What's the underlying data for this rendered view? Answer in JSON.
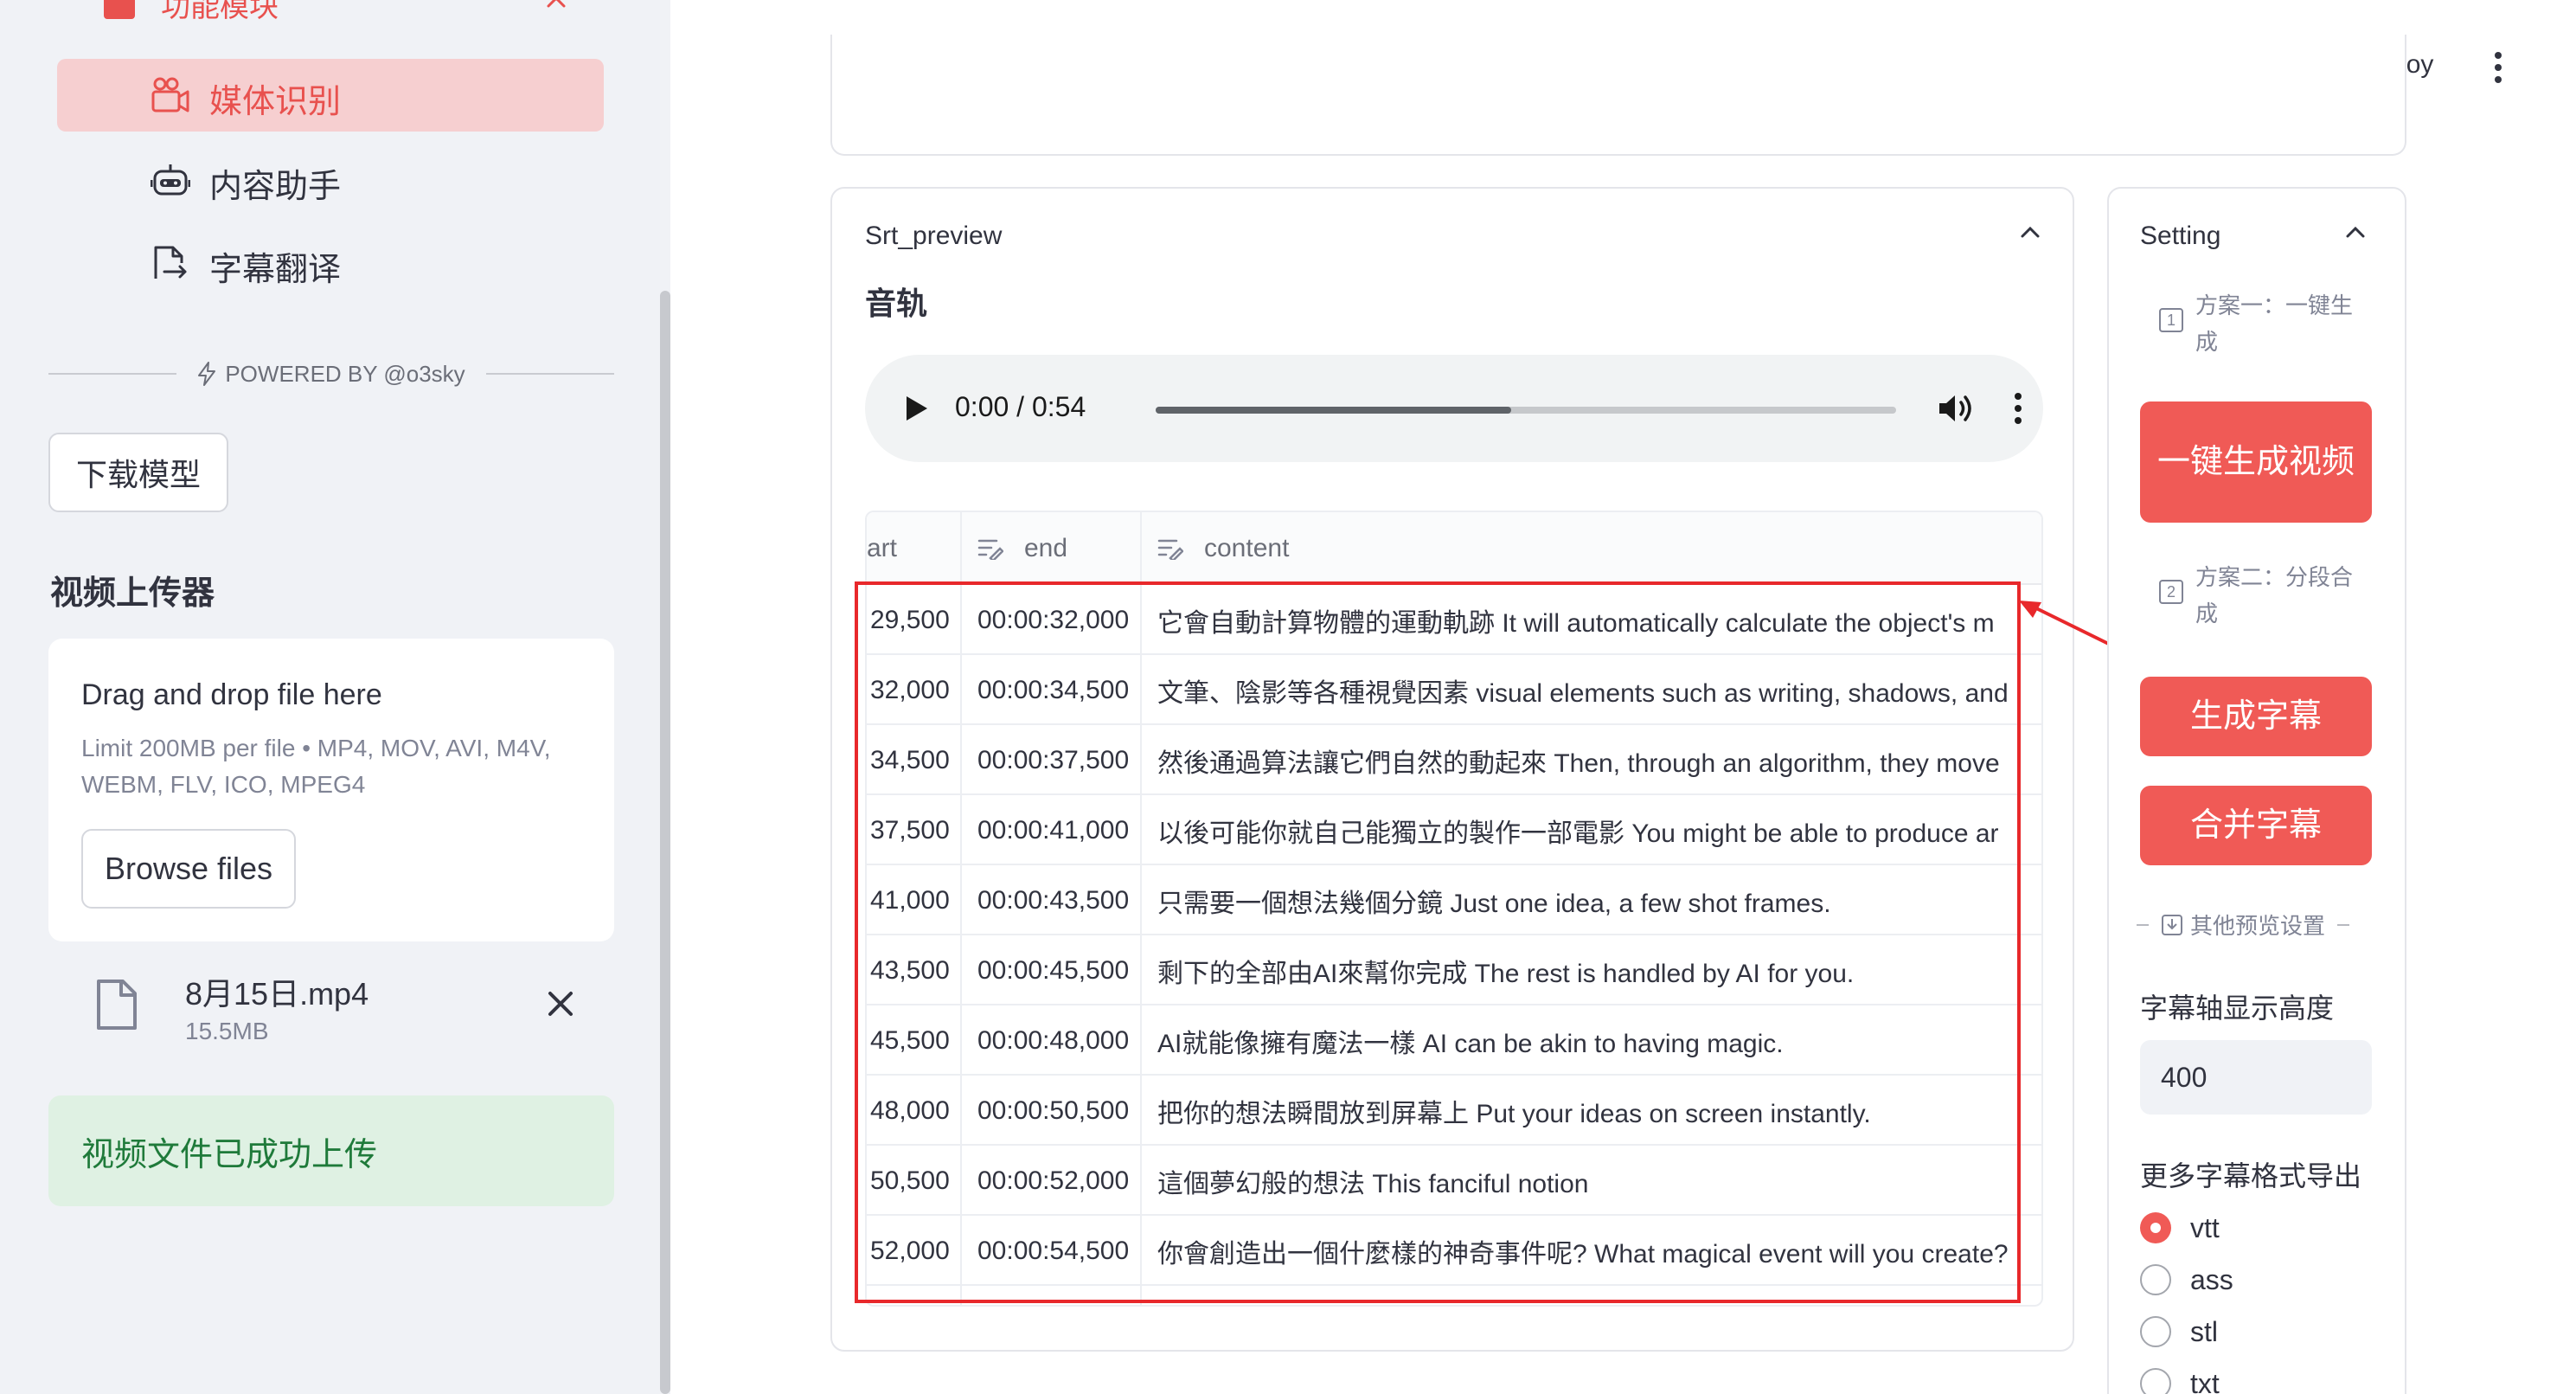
{
  "sidebar": {
    "header": {
      "label": "功能模块"
    },
    "nav": [
      {
        "label": "媒体识别",
        "icon": "media-recognition-icon",
        "active": true
      },
      {
        "label": "内容助手",
        "icon": "robot-icon",
        "active": false
      },
      {
        "label": "字幕翻译",
        "icon": "document-translate-icon",
        "active": false
      }
    ],
    "powered_by": "POWERED BY @o3sky",
    "download_model_label": "下载模型",
    "uploader_heading": "视频上传器",
    "dropzone": {
      "title": "Drag and drop file here",
      "limit": "Limit 200MB per file • MP4, MOV, AVI, M4V, WEBM, FLV, ICO, MPEG4",
      "browse_label": "Browse files"
    },
    "uploaded_file": {
      "name": "8月15日.mp4",
      "size": "15.5MB"
    },
    "success_message": "视频文件已成功上传"
  },
  "topbar": {
    "deploy_label": "Deploy"
  },
  "srt_preview": {
    "title": "Srt_preview",
    "audio_heading": "音轨",
    "audio": {
      "time": "0:00 / 0:54",
      "progress": 0.48
    },
    "columns": {
      "start": "art",
      "end": "end",
      "content": "content"
    },
    "rows": [
      {
        "start": "29,500",
        "end": "00:00:32,000",
        "content": "它會自動計算物體的運動軌跡 It will automatically calculate the object's m"
      },
      {
        "start": "32,000",
        "end": "00:00:34,500",
        "content": "文筆、陰影等各種視覺因素 visual elements such as writing, shadows, and"
      },
      {
        "start": "34,500",
        "end": "00:00:37,500",
        "content": "然後通過算法讓它們自然的動起來 Then, through an algorithm, they move"
      },
      {
        "start": "37,500",
        "end": "00:00:41,000",
        "content": "以後可能你就自己能獨立的製作一部電影 You might be able to produce ar"
      },
      {
        "start": "41,000",
        "end": "00:00:43,500",
        "content": "只需要一個想法幾個分鏡 Just one idea, a few shot frames."
      },
      {
        "start": "43,500",
        "end": "00:00:45,500",
        "content": "剩下的全部由AI來幫你完成 The rest is handled by AI for you."
      },
      {
        "start": "45,500",
        "end": "00:00:48,000",
        "content": "AI就能像擁有魔法一樣 AI can be akin to having magic."
      },
      {
        "start": "48,000",
        "end": "00:00:50,500",
        "content": "把你的想法瞬間放到屏幕上 Put your ideas on screen instantly."
      },
      {
        "start": "50,500",
        "end": "00:00:52,000",
        "content": "這個夢幻般的想法 This fanciful notion"
      },
      {
        "start": "52,000",
        "end": "00:00:54,500",
        "content": "你會創造出一個什麼樣的神奇事件呢? What magical event will you create?"
      }
    ]
  },
  "setting": {
    "title": "Setting",
    "plan1_label": "方案一：一键生成",
    "plan1_button": "一键生成视频",
    "plan2_label": "方案二：分段合成",
    "generate_subtitle_button": "生成字幕",
    "merge_subtitle_button": "合并字幕",
    "other_settings_label": "其他预览设置",
    "subtitle_height_label": "字幕轴显示高度",
    "subtitle_height_value": "400",
    "export_formats_label": "更多字幕格式导出",
    "formats": [
      {
        "label": "vtt",
        "selected": true
      },
      {
        "label": "ass",
        "selected": false
      },
      {
        "label": "stl",
        "selected": false
      },
      {
        "label": "txt",
        "selected": false
      }
    ]
  },
  "colors": {
    "accent": "#f05a56",
    "annotation": "#e8282b",
    "success_bg": "#dff1e3",
    "success_text": "#1f7a3a"
  }
}
